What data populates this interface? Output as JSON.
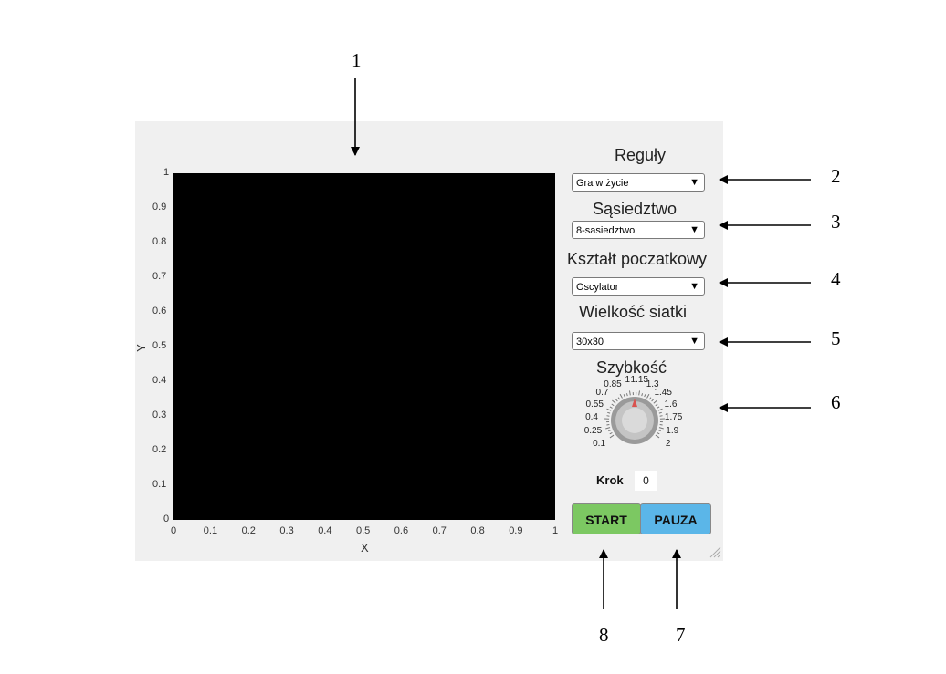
{
  "callouts": [
    "1",
    "2",
    "3",
    "4",
    "5",
    "6",
    "7",
    "8"
  ],
  "plot": {
    "x_label": "X",
    "y_label": "Y",
    "x_ticks": [
      "0",
      "0.1",
      "0.2",
      "0.3",
      "0.4",
      "0.5",
      "0.6",
      "0.7",
      "0.8",
      "0.9",
      "1"
    ],
    "y_ticks": [
      "1",
      "0.9",
      "0.8",
      "0.7",
      "0.6",
      "0.5",
      "0.4",
      "0.3",
      "0.2",
      "0.1",
      "0"
    ],
    "background": "#000000"
  },
  "controls": {
    "rules": {
      "label": "Reguły",
      "value": "Gra w życie"
    },
    "neighborhood": {
      "label": "Sąsiedztwo",
      "value": "8-sasiedztwo"
    },
    "initial_shape": {
      "label": "Kształt poczatkowy",
      "value": "Oscylator"
    },
    "grid_size": {
      "label": "Wielkość siatki",
      "value": "30x30"
    },
    "speed": {
      "label": "Szybkość",
      "value": 1,
      "scale_labels": [
        "0.1",
        "0.25",
        "0.4",
        "0.55",
        "0.7",
        "0.85",
        "1",
        "1.15",
        "1.3",
        "1.45",
        "1.6",
        "1.75",
        "1.9",
        "2"
      ],
      "pointer_color": "#d9534f"
    },
    "step": {
      "label": "Krok",
      "value": "0"
    },
    "start_button": {
      "label": "START",
      "color": "#7cc862"
    },
    "pause_button": {
      "label": "PAUZA",
      "color": "#5bb6e8"
    },
    "dropdown_arrow": "▼"
  }
}
